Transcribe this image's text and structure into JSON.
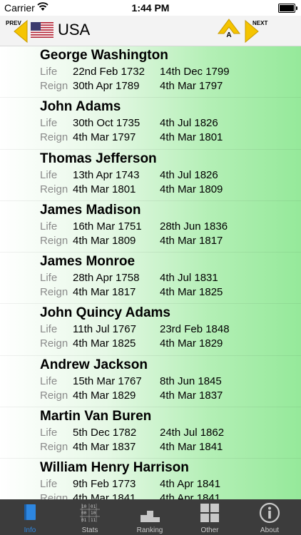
{
  "status_bar": {
    "carrier": "Carrier",
    "time": "1:44 PM"
  },
  "header": {
    "prev_label": "PREV",
    "next_label": "NEXT",
    "country": "USA",
    "alpha_letter": "A",
    "accent_color": "#f5c400"
  },
  "field_labels": {
    "life": "Life",
    "reign": "Reign"
  },
  "presidents": [
    {
      "name": "George Washington",
      "life": [
        "22nd Feb 1732",
        "14th Dec 1799"
      ],
      "reign": [
        "30th Apr 1789",
        "4th Mar 1797"
      ]
    },
    {
      "name": "John Adams",
      "life": [
        "30th Oct 1735",
        "4th Jul 1826"
      ],
      "reign": [
        "4th Mar 1797",
        "4th Mar 1801"
      ]
    },
    {
      "name": "Thomas Jefferson",
      "life": [
        "13th Apr 1743",
        "4th Jul 1826"
      ],
      "reign": [
        "4th Mar 1801",
        "4th Mar 1809"
      ]
    },
    {
      "name": "James Madison",
      "life": [
        "16th Mar 1751",
        "28th Jun 1836"
      ],
      "reign": [
        "4th Mar 1809",
        "4th Mar 1817"
      ]
    },
    {
      "name": "James Monroe",
      "life": [
        "28th Apr 1758",
        "4th Jul 1831"
      ],
      "reign": [
        "4th Mar 1817",
        "4th Mar 1825"
      ]
    },
    {
      "name": "John Quincy Adams",
      "life": [
        "11th Jul 1767",
        "23rd Feb 1848"
      ],
      "reign": [
        "4th Mar 1825",
        "4th Mar 1829"
      ]
    },
    {
      "name": "Andrew Jackson",
      "life": [
        "15th Mar 1767",
        "8th Jun 1845"
      ],
      "reign": [
        "4th Mar 1829",
        "4th Mar 1837"
      ]
    },
    {
      "name": "Martin Van Buren",
      "life": [
        "5th Dec 1782",
        "24th Jul 1862"
      ],
      "reign": [
        "4th Mar 1837",
        "4th Mar 1841"
      ]
    },
    {
      "name": "William Henry Harrison",
      "life": [
        "9th Feb 1773",
        "4th Apr 1841"
      ],
      "reign": [
        "4th Mar 1841",
        "4th Apr 1841"
      ]
    }
  ],
  "tabs": [
    {
      "label": "Info",
      "icon": "book-icon",
      "active": true
    },
    {
      "label": "Stats",
      "icon": "binary-grid-icon",
      "active": false
    },
    {
      "label": "Ranking",
      "icon": "podium-icon",
      "active": false
    },
    {
      "label": "Other",
      "icon": "grid-squares-icon",
      "active": false
    },
    {
      "label": "About",
      "icon": "info-circle-icon",
      "active": false
    }
  ],
  "colors": {
    "tab_active": "#2d86e0",
    "tab_bar_bg": "#3c3c3c",
    "list_green": "#95e99a"
  }
}
